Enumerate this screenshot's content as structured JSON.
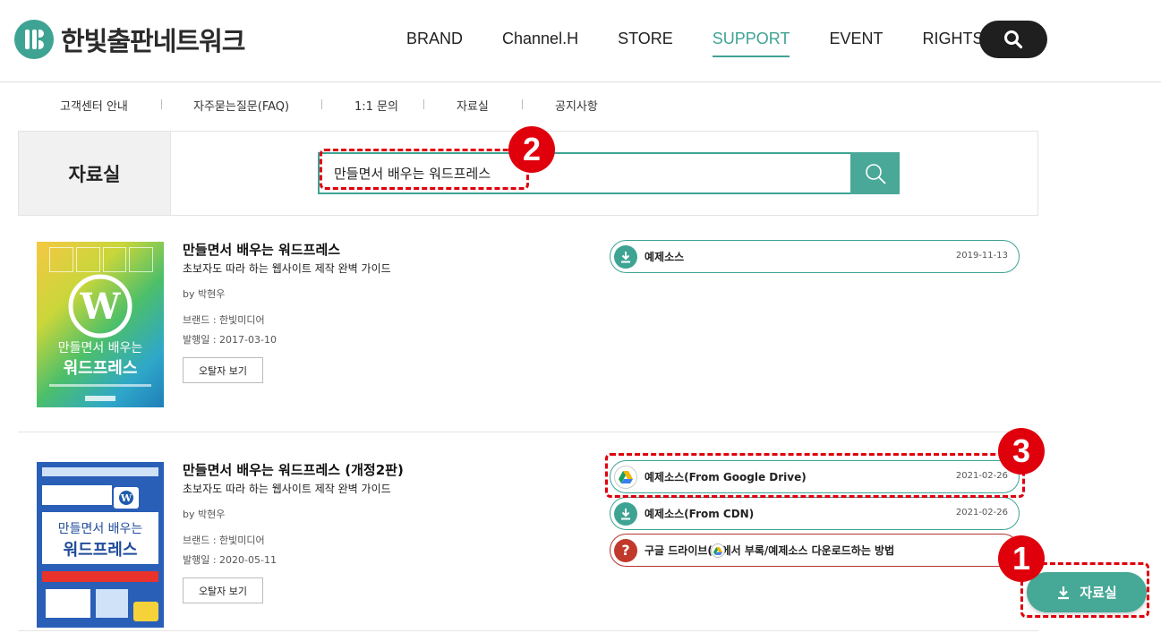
{
  "header": {
    "logo_text": "한빛출판네트워크",
    "nav": [
      "BRAND",
      "Channel.H",
      "STORE",
      "SUPPORT",
      "EVENT",
      "RIGHTS"
    ],
    "active_nav": "SUPPORT"
  },
  "subnav": [
    "고객센터 안내",
    "자주묻는질문(FAQ)",
    "1:1 문의",
    "자료실",
    "공지사항"
  ],
  "search": {
    "section_label": "자료실",
    "query": "만들면서 배우는 워드프레스"
  },
  "books": [
    {
      "title": "만들면서 배우는 워드프레스",
      "subtitle": "초보자도 따라 하는 웹사이트 제작 완벽 가이드",
      "author": "by 박현우",
      "brand": "브랜드 : 한빛미디어",
      "date": "발행일 : 2017-03-10",
      "errata": "오탈자 보기",
      "cover_title_1": "만들면서 배우는",
      "cover_title_2": "워드프레스",
      "downloads": [
        {
          "label": "예제소스",
          "date": "2019-11-13",
          "icon": "download-icon"
        }
      ]
    },
    {
      "title": "만들면서 배우는 워드프레스 (개정2판)",
      "subtitle": "초보자도 따라 하는 웹사이트 제작 완벽 가이드",
      "author": "by 박현우",
      "brand": "브랜드 : 한빛미디어",
      "date": "발행일 : 2020-05-11",
      "errata": "오탈자 보기",
      "cover_title_1": "만들면서 배우는",
      "cover_title_2": "워드프레스",
      "downloads": [
        {
          "label": "예제소스(From Google Drive)",
          "date": "2021-02-26",
          "icon": "google-drive-icon"
        },
        {
          "label": "예제소스(From CDN)",
          "date": "2021-02-26",
          "icon": "download-icon"
        },
        {
          "label": "구글 드라이브(  )에서 부록/예제소스 다운로드하는 방법",
          "date": "",
          "icon": "question-icon"
        }
      ]
    }
  ],
  "float_button": "자료실",
  "annotations": [
    "1",
    "2",
    "3"
  ],
  "colors": {
    "accent": "#3fa394",
    "annotation": "#e0000c",
    "help": "#b83232"
  }
}
